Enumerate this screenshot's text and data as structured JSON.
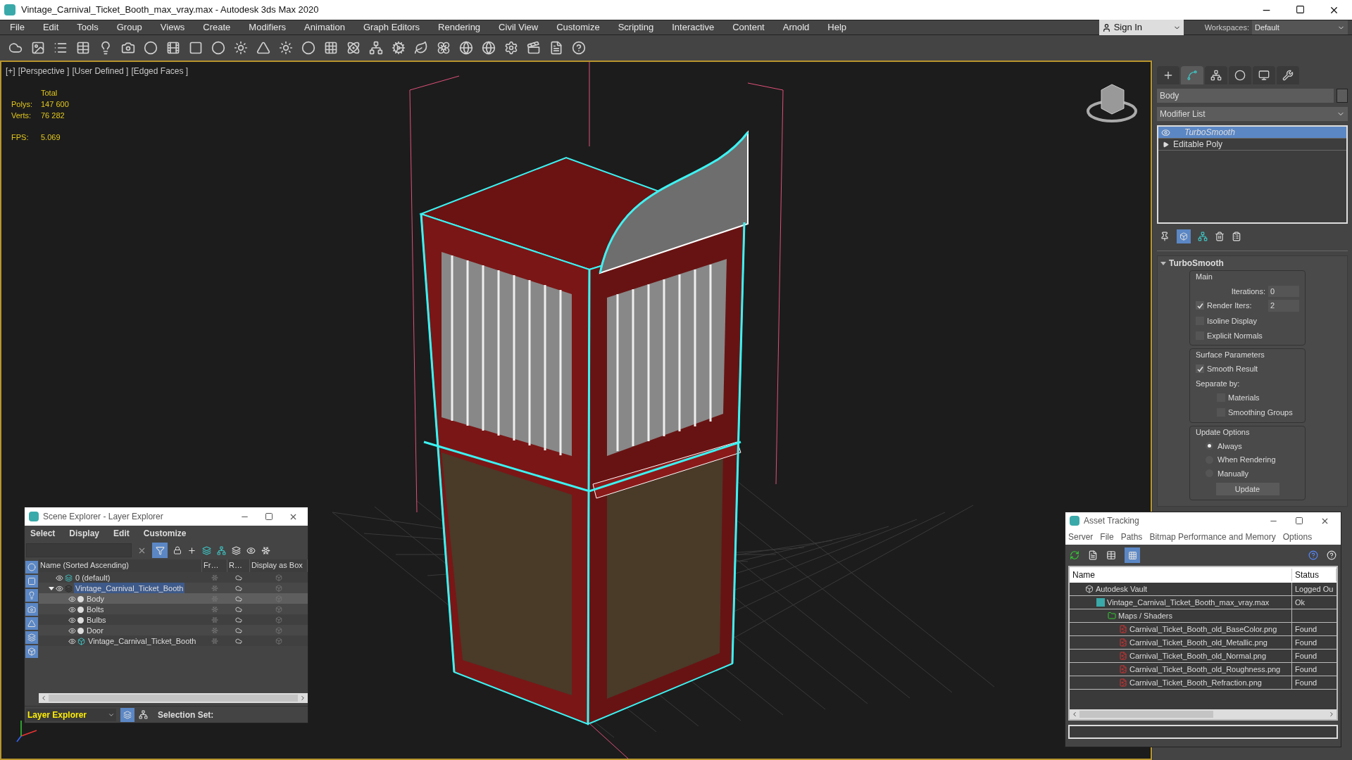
{
  "window": {
    "title": "Vintage_Carnival_Ticket_Booth_max_vray.max - Autodesk 3ds Max 2020"
  },
  "menu": [
    "File",
    "Edit",
    "Tools",
    "Group",
    "Views",
    "Create",
    "Modifiers",
    "Animation",
    "Graph Editors",
    "Rendering",
    "Civil View",
    "Customize",
    "Scripting",
    "Interactive",
    "Content",
    "Arnold",
    "Help"
  ],
  "sign_in": {
    "label": "Sign In"
  },
  "workspaces": {
    "label": "Workspaces:",
    "value": "Default"
  },
  "viewport": {
    "labels": [
      "[+]",
      "[Perspective ]",
      "[User Defined ]",
      "[Edged Faces ]"
    ],
    "stats_heading": "Total",
    "stats": [
      {
        "label": "Polys:",
        "value": "147 600"
      },
      {
        "label": "Verts:",
        "value": "76 282"
      }
    ],
    "fps": {
      "label": "FPS:",
      "value": "5.069"
    }
  },
  "command_panel": {
    "tabs": [
      {
        "selected": false
      },
      {
        "selected": true
      },
      {
        "selected": false
      },
      {
        "selected": false
      },
      {
        "selected": false
      },
      {
        "selected": false
      }
    ],
    "object_name": "Body",
    "modifier_list": "Modifier List",
    "stack": [
      {
        "label": "TurboSmooth",
        "selected": true,
        "kind": "modifier"
      },
      {
        "label": "Editable Poly",
        "selected": false,
        "kind": "base"
      }
    ],
    "rollout": {
      "title": "TurboSmooth",
      "expanded": true,
      "main": {
        "title": "Main",
        "iterations": {
          "label": "Iterations:",
          "value": "0"
        },
        "render_iters": {
          "label": "Render Iters:",
          "value": "2",
          "checked": true
        },
        "options": [
          {
            "label": "Isoline Display",
            "checked": false
          },
          {
            "label": "Explicit Normals",
            "checked": false
          }
        ]
      },
      "surface": {
        "title": "Surface Parameters",
        "smooth_result": {
          "label": "Smooth Result",
          "checked": true
        },
        "separate_by": "Separate by:",
        "options": [
          {
            "label": "Materials",
            "checked": false
          },
          {
            "label": "Smoothing Groups",
            "checked": false
          }
        ]
      },
      "update": {
        "title": "Update Options",
        "radios": [
          {
            "label": "Always",
            "selected": true
          },
          {
            "label": "When Rendering",
            "selected": false
          },
          {
            "label": "Manually",
            "selected": false
          }
        ],
        "button": "Update"
      }
    }
  },
  "scene_explorer": {
    "title": "Scene Explorer - Layer Explorer",
    "menu": [
      "Select",
      "Display",
      "Edit",
      "Customize"
    ],
    "columns": [
      "Name (Sorted Ascending)",
      "Fr…",
      "R…",
      "Display as Box"
    ],
    "rows": [
      {
        "name": "0 (default)",
        "kind": "layer",
        "selected": false,
        "active": false
      },
      {
        "name": "Vintage_Carnival_Ticket_Booth",
        "kind": "layer",
        "selected": false,
        "active": true,
        "expanded": true,
        "children": [
          {
            "name": "Body",
            "kind": "object",
            "selected": true,
            "active": false
          },
          {
            "name": "Bolts",
            "kind": "object",
            "selected": false,
            "active": false
          },
          {
            "name": "Bulbs",
            "kind": "object",
            "selected": false,
            "active": false
          },
          {
            "name": "Door",
            "kind": "object",
            "selected": false,
            "active": false
          },
          {
            "name": "Vintage_Carnival_Ticket_Booth",
            "kind": "group",
            "selected": false,
            "active": false
          }
        ]
      }
    ],
    "footer": {
      "explorer": "Layer Explorer",
      "selection_set": "Selection Set:"
    }
  },
  "asset_tracking": {
    "title": "Asset Tracking",
    "menu": [
      "Server",
      "File",
      "Paths",
      "Bitmap Performance and Memory",
      "Options"
    ],
    "columns": [
      "Name",
      "Status"
    ],
    "rows": [
      {
        "name": "Autodesk Vault",
        "kind": "vault",
        "status": "Logged Ou",
        "children": [
          {
            "name": "Vintage_Carnival_Ticket_Booth_max_vray.max",
            "kind": "scene",
            "status": "Ok",
            "children": [
              {
                "name": "Maps / Shaders",
                "kind": "folder",
                "children": [
                  {
                    "name": "Carnival_Ticket_Booth_old_BaseColor.png",
                    "kind": "png",
                    "status": "Found"
                  },
                  {
                    "name": "Carnival_Ticket_Booth_old_Metallic.png",
                    "kind": "png",
                    "status": "Found"
                  },
                  {
                    "name": "Carnival_Ticket_Booth_old_Normal.png",
                    "kind": "png",
                    "status": "Found"
                  },
                  {
                    "name": "Carnival_Ticket_Booth_old_Roughness.png",
                    "kind": "png",
                    "status": "Found"
                  },
                  {
                    "name": "Carnival_Ticket_Booth_Refraction.png",
                    "kind": "png",
                    "status": "Found"
                  }
                ]
              }
            ]
          }
        ]
      }
    ]
  }
}
